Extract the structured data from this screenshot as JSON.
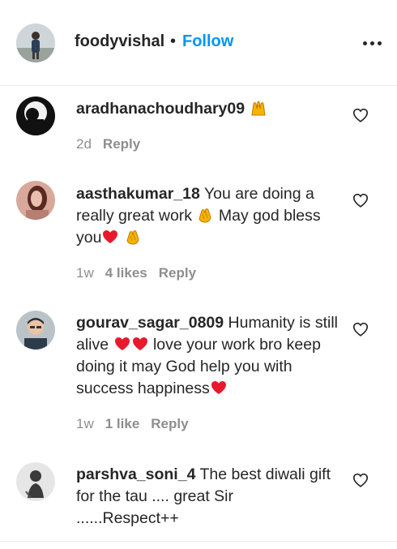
{
  "post": {
    "username": "foodyvishal",
    "separator": "•",
    "follow_label": "Follow",
    "more_icon": "more-horizontal-icon"
  },
  "comments": [
    {
      "username": "aradhanachoudhary09",
      "text": "",
      "emojis": [
        "raising-hands"
      ],
      "time": "2d",
      "likes": "",
      "reply_label": "Reply"
    },
    {
      "username": "aasthakumar_18",
      "text_parts": [
        "You are doing a really great work",
        "May god bless you"
      ],
      "time": "1w",
      "likes": "4 likes",
      "reply_label": "Reply"
    },
    {
      "username": "gourav_sagar_0809",
      "text_parts": [
        "Humanity is still alive",
        "love your work bro keep doing it may God help you with success happiness"
      ],
      "time": "1w",
      "likes": "1 like",
      "reply_label": "Reply"
    },
    {
      "username": "parshva_soni_4",
      "text": "The best diwali gift for the tau .... great Sir ......Respect++",
      "time": "",
      "likes": "",
      "reply_label": ""
    }
  ],
  "colors": {
    "follow": "#0095f6",
    "text": "#262626",
    "muted": "#8e8e8e",
    "heart_emoji": "#e8192c",
    "clap_emoji": "#f4b400"
  }
}
